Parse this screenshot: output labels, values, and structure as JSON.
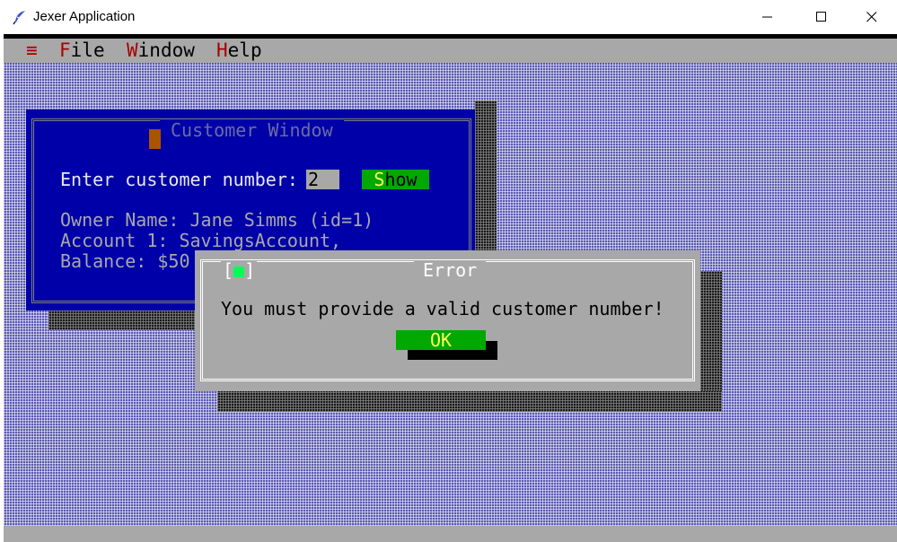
{
  "window": {
    "title": "Jexer Application",
    "icon": "feather-quill-icon"
  },
  "menubar": {
    "system_glyph": "≡",
    "items": [
      {
        "hotkey": "F",
        "rest": "ile"
      },
      {
        "hotkey": "W",
        "rest": "indow"
      },
      {
        "hotkey": "H",
        "rest": "elp"
      }
    ]
  },
  "customer_window": {
    "title": "Customer Window",
    "prompt": "Enter customer number:",
    "customer_number": "2",
    "show_button": {
      "hotkey": "S",
      "rest": "how"
    },
    "owner_line": "Owner Name: Jane Simms (id=1)",
    "account_line": "Account 1: SavingsAccount,",
    "balance_line": "Balance: $50"
  },
  "error_dialog": {
    "close_box": {
      "left": "[",
      "mark": "■",
      "right": "]"
    },
    "title": "Error",
    "message": "You must provide a valid customer number!",
    "ok_label": "OK"
  },
  "colors": {
    "desktop": "#5a5ab4",
    "window_blue": "#0000a8",
    "dialog_gray": "#a8a8a8",
    "button_green": "#00a800",
    "hotkey_red": "#a80000",
    "hotkey_yellow": "#ffff54"
  }
}
